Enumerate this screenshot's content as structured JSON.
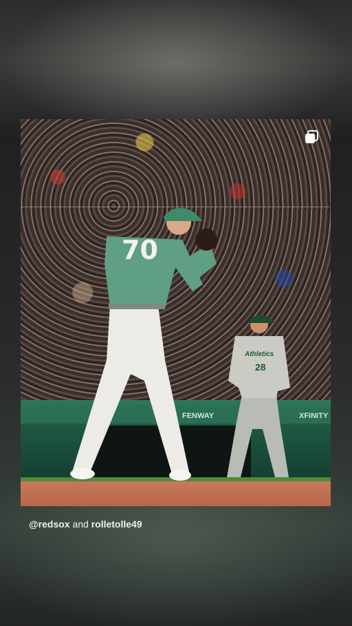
{
  "post": {
    "pitcher_number": "70",
    "coach_number": "28",
    "coach_jersey_text": "Athletics",
    "wall_ads": [
      "FENWAY",
      "XFINITY"
    ],
    "media_icon": "multiple-photos-icon"
  },
  "credit": {
    "handle_1": "@redsox",
    "connector": "and",
    "handle_2": "rolletolle49"
  },
  "colors": {
    "pitcher_jersey": "#5f9f86",
    "wall_green": "#1e5a43",
    "dirt": "#b8674a"
  }
}
